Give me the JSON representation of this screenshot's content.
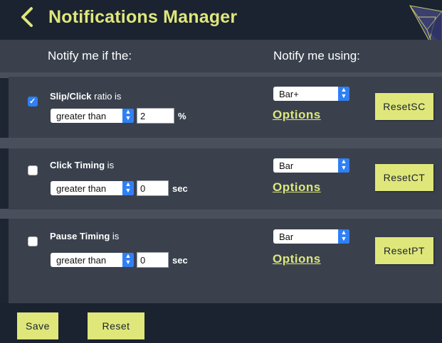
{
  "header": {
    "title": "Notifications Manager"
  },
  "columns": {
    "condition": "Notify me if the:",
    "method": "Notify me using:"
  },
  "rules": [
    {
      "checked": true,
      "name": "Slip/Click",
      "suffix": " ratio is",
      "comparator": "greater than",
      "value": "2",
      "unit": "%",
      "method": "Bar+",
      "options_label": "Options",
      "reset_label": "ResetSC"
    },
    {
      "checked": false,
      "name": "Click Timing",
      "suffix": " is",
      "comparator": "greater than",
      "value": "0",
      "unit": "sec",
      "method": "Bar",
      "options_label": "Options",
      "reset_label": "ResetCT"
    },
    {
      "checked": false,
      "name": "Pause Timing",
      "suffix": " is",
      "comparator": "greater than",
      "value": "0",
      "unit": "sec",
      "method": "Bar",
      "options_label": "Options",
      "reset_label": "ResetPT"
    }
  ],
  "footer": {
    "save_label": "Save",
    "reset_label": "Reset"
  },
  "colors": {
    "accent": "#dfe77a",
    "background": "#1e2532",
    "panel": "#3a414d",
    "checkbox": "#2f7ff5"
  }
}
